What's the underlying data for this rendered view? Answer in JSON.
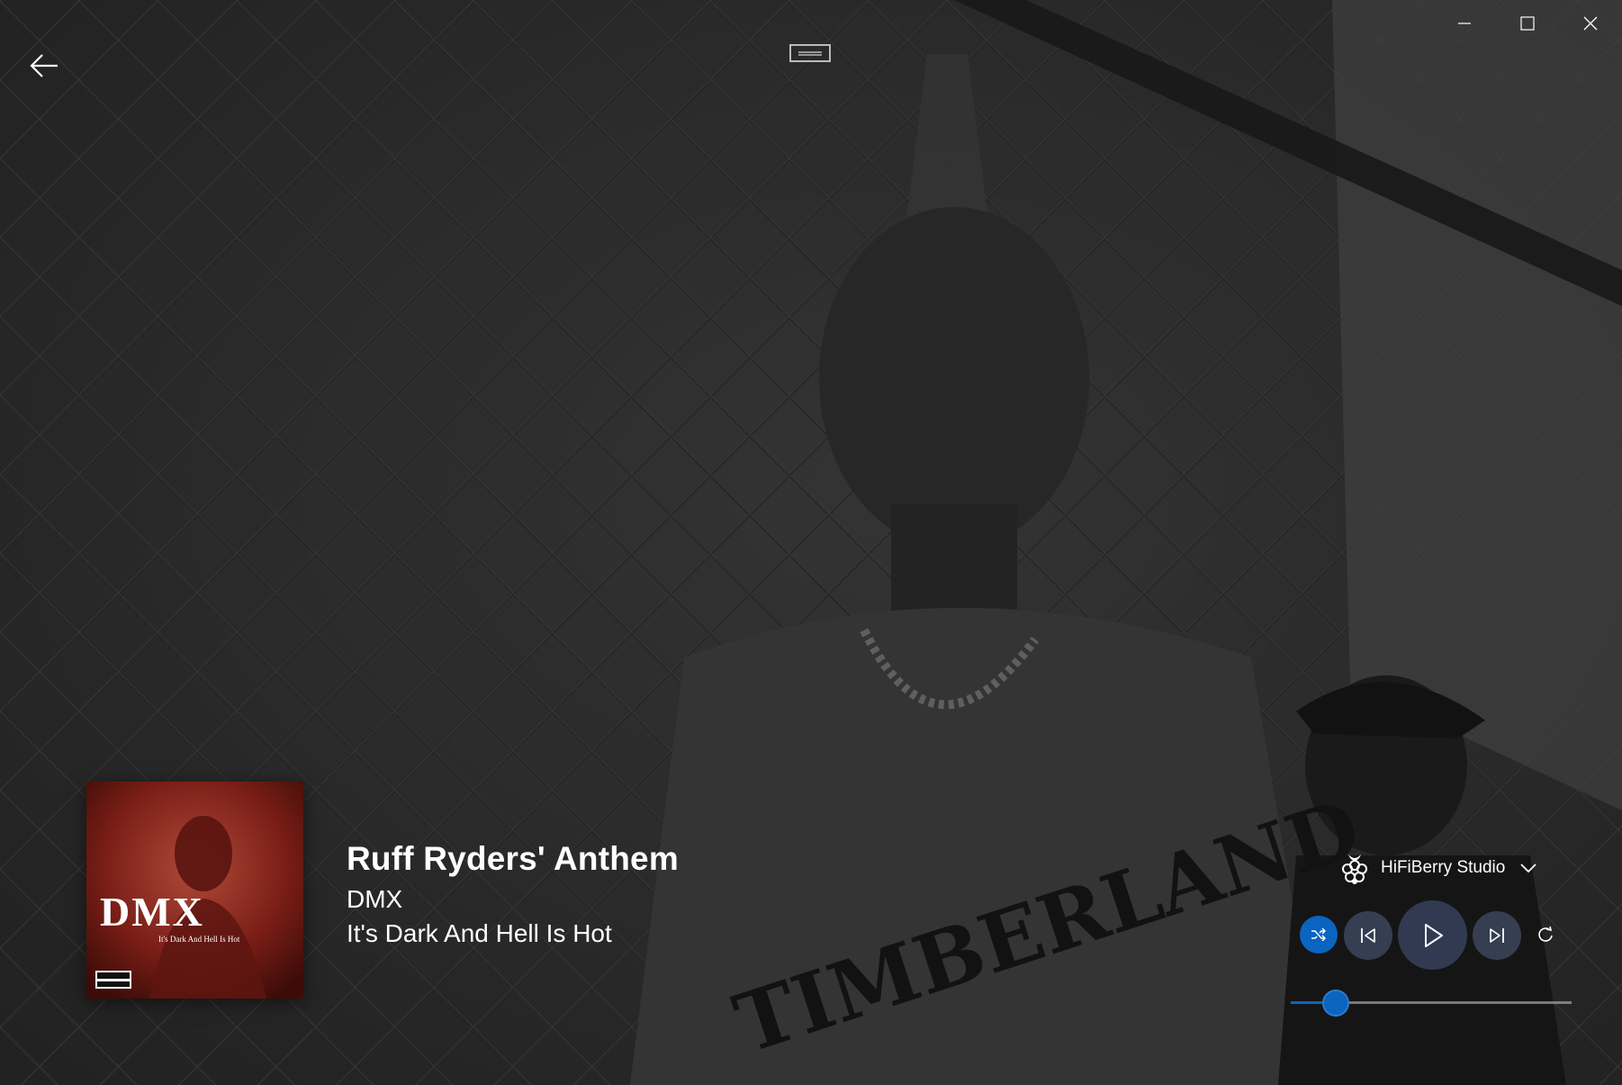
{
  "track": {
    "title": "Ruff Ryders' Anthem",
    "artist": "DMX",
    "album": "It's Dark And Hell Is Hot"
  },
  "album_art": {
    "title_text": "DMX",
    "subtitle_text": "It's Dark And Hell Is Hot"
  },
  "device": {
    "name": "HiFiBerry Studio",
    "icon": "raspberry-pi-icon"
  },
  "controls": {
    "shuffle_icon": "shuffle-icon",
    "shuffle_active": true,
    "previous_icon": "previous-icon",
    "play_icon": "play-icon",
    "next_icon": "next-icon",
    "repeat_icon": "repeat-icon"
  },
  "progress": {
    "fraction": 0.16
  },
  "window": {
    "back_icon": "back-arrow-icon",
    "compact_icon": "compact-overlay-icon",
    "minimize_icon": "minimize-icon",
    "maximize_icon": "maximize-icon",
    "close_icon": "close-icon"
  },
  "colors": {
    "accent": "#0a64c0",
    "background": "#1e1e1e",
    "button_bg": "#3c465c"
  }
}
